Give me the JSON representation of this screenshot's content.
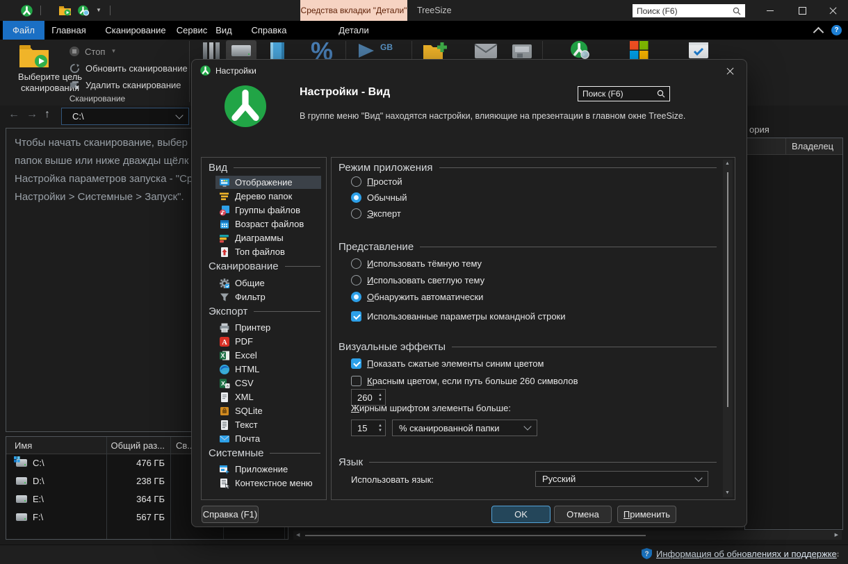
{
  "window": {
    "tool_tab": "Средства вкладки \"Детали\"",
    "title": "TreeSize",
    "search_placeholder": "Поиск (F6)"
  },
  "menu": {
    "file": "Файл",
    "home": "Главная",
    "scan": "Сканирование",
    "service": "Сервис",
    "view": "Вид",
    "help": "Справка",
    "details": "Детали"
  },
  "ribbon": {
    "select_target": "Выберите цель сканирования",
    "stop": "Стоп",
    "refresh": "Обновить сканирование",
    "delete": "Удалить сканирование",
    "group_label": "Сканирование",
    "gb_badge": "GB",
    "percent_glyph": "%"
  },
  "address_bar": {
    "path": "C:\\"
  },
  "info_panel": {
    "line1": "Чтобы начать сканирование, выбер",
    "line2": "папок выше или ниже дважды щёлк",
    "line3": "Настройка параметров запуска - \"Ср",
    "line4": "Настройки > Системные > Запуск\"."
  },
  "drive_table": {
    "col_name": "Имя",
    "col_size": "Общий раз...",
    "col_free": "Св...",
    "rows": [
      {
        "name": "C:\\",
        "size": "476 ГБ"
      },
      {
        "name": "D:\\",
        "size": "238 ГБ"
      },
      {
        "name": "E:\\",
        "size": "364 ГБ"
      },
      {
        "name": "F:\\",
        "size": "567 ГБ"
      }
    ]
  },
  "right_panel": {
    "history_fragment": "ория",
    "owner_column": "Владелец"
  },
  "status_bar": {
    "update_link": "Информация об обновлениях и поддержке"
  },
  "dialog": {
    "title": "Настройки",
    "heading": "Настройки - Вид",
    "description": "В группе меню \"Вид\" находятся настройки, влияющие на презентации в главном окне TreeSize.",
    "search_placeholder": "Поиск (F6)",
    "nav": {
      "sections": [
        {
          "title": "Вид",
          "items": [
            {
              "label": "Отображение",
              "icon": "display-icon",
              "selected": true
            },
            {
              "label": "Дерево папок",
              "icon": "folder-tree-icon"
            },
            {
              "label": "Группы файлов",
              "icon": "file-groups-icon"
            },
            {
              "label": "Возраст файлов",
              "icon": "file-age-icon"
            },
            {
              "label": "Диаграммы",
              "icon": "charts-icon"
            },
            {
              "label": "Топ файлов",
              "icon": "top-files-icon"
            }
          ]
        },
        {
          "title": "Сканирование",
          "items": [
            {
              "label": "Общие",
              "icon": "gear-icon"
            },
            {
              "label": "Фильтр",
              "icon": "filter-icon"
            }
          ]
        },
        {
          "title": "Экспорт",
          "items": [
            {
              "label": "Принтер",
              "icon": "printer-icon"
            },
            {
              "label": "PDF",
              "icon": "pdf-icon"
            },
            {
              "label": "Excel",
              "icon": "excel-icon"
            },
            {
              "label": "HTML",
              "icon": "html-icon"
            },
            {
              "label": "CSV",
              "icon": "csv-icon"
            },
            {
              "label": "XML",
              "icon": "xml-icon"
            },
            {
              "label": "SQLite",
              "icon": "sqlite-icon"
            },
            {
              "label": "Текст",
              "icon": "text-icon"
            },
            {
              "label": "Почта",
              "icon": "mail-icon"
            }
          ]
        },
        {
          "title": "Системные",
          "items": [
            {
              "label": "Приложение",
              "icon": "app-icon"
            },
            {
              "label": "Контекстное меню",
              "icon": "context-menu-icon"
            }
          ]
        }
      ]
    },
    "content": {
      "app_mode": {
        "title": "Режим приложения",
        "simple": "Простой",
        "normal": "Обычный",
        "expert": "Эксперт"
      },
      "presentation": {
        "title": "Представление",
        "dark": "Использовать тёмную тему",
        "light": "Использовать светлую тему",
        "auto": "Обнаружить автоматически",
        "cmdline": "Использованные параметры командной строки"
      },
      "effects": {
        "title": "Визуальные эффекты",
        "compressed_blue": "Показать сжатые элементы синим цветом",
        "red_long_path": "Красным цветом, если путь больше 260 символов",
        "path_len_value": "260",
        "bold_label": "Жирным шрифтом элементы больше:",
        "bold_value": "15",
        "bold_unit": "% сканированной папки"
      },
      "language": {
        "title": "Язык",
        "use_label": "Использовать язык:",
        "value": "Русский"
      }
    },
    "footer": {
      "help": "Справка (F1)",
      "ok": "OK",
      "cancel": "Отмена",
      "apply": "Применить"
    }
  },
  "colors": {
    "accent_blue": "#2da0e8",
    "file_tab_blue": "#1a6fc4",
    "tool_tab_peach": "#f6d3c2",
    "logo_green": "#21a546",
    "ok_button_bg": "#24465a"
  }
}
